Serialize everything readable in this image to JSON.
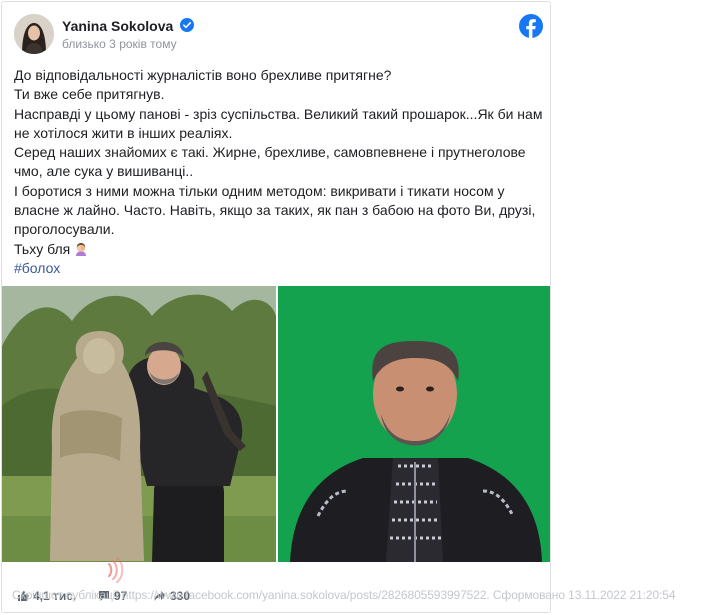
{
  "post": {
    "author": "Yanina Sokolova",
    "timestamp": "близько 3 років тому",
    "lines": [
      "До відповідальності журналістів воно брехливе притягне?",
      "Ти вже себе притягнув.",
      "Насправді у цьому панові - зріз суспільства. Великий такий прошарок...Як би нам не хотілося жити в інших реаліях.",
      "Серед наших знайомих є такі. Жирне, брехливе, самовпевнене і прутнеголове чмо, але сука у вишиванці..",
      "І боротися з ними можна тільки одним методом: викривати і тикати носом у власне ж лайно. Часто. Навіть, якщо за таких, як пан з бабою на фото Ви, друзі, проголосували."
    ],
    "last_line": "Тьху бля",
    "hashtag": "#болох"
  },
  "stats": {
    "likes": "4,1 тис.",
    "comments": "97",
    "shares": "330"
  },
  "caption": "Скріншот публікації https://www.facebook.com/yanina.sokolova/posts/2826805593997522. Сформовано 13.11.2022 21:20:54",
  "colors": {
    "facebook_blue": "#1877f2",
    "hashtag": "#385898",
    "photo_bg_green": "#14a24f"
  },
  "icons": [
    "verified-badge-icon",
    "facebook-logo-icon",
    "like-icon",
    "comment-icon",
    "share-icon",
    "face-palm-emoji-icon",
    "sound-waves-icon"
  ]
}
